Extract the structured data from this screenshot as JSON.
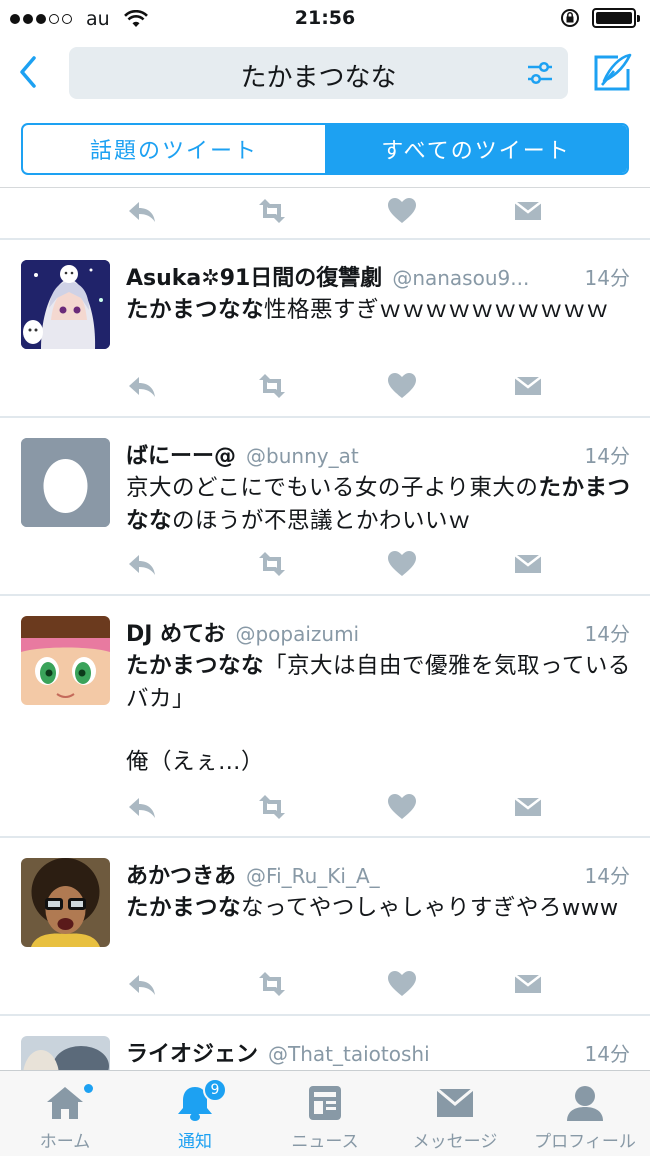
{
  "status_bar": {
    "carrier": "au",
    "time": "21:56"
  },
  "search": {
    "query": "たかまつなな"
  },
  "segments": [
    {
      "label": "話題のツイート",
      "active": false
    },
    {
      "label": "すべてのツイート",
      "active": true
    }
  ],
  "tweets": [
    {
      "name": "Asuka✲91日間の復讐劇",
      "handle": "@nanasou9...",
      "time": "14分",
      "body_bold": "たかまつなな",
      "body_rest": "性格悪すぎｗｗｗｗｗｗｗｗｗｗ"
    },
    {
      "name": "ばにーー@",
      "handle": "@bunny_at",
      "time": "14分",
      "body_pre": "京大のどこにでもいる女の子より東大の",
      "body_bold": "たかまつなな",
      "body_rest": "のほうが不思議とかわいいｗ"
    },
    {
      "name": "DJ めてお",
      "handle": "@popaizumi",
      "time": "14分",
      "body_bold": "たかまつなな",
      "body_rest": "「京大は自由で優雅を気取っているバカ」",
      "body_extra": "俺（えぇ…）"
    },
    {
      "name": "あかつきあ",
      "handle": "@Fi_Ru_Ki_A_",
      "time": "14分",
      "body_bold": "たかまつな",
      "body_rest": "なってやつしゃしゃりすぎやろwww"
    },
    {
      "name": "ライオジェン",
      "handle": "@That_taiotoshi",
      "time": "14分"
    }
  ],
  "tab_bar": {
    "tabs": [
      {
        "label": "ホーム",
        "icon": "home-icon"
      },
      {
        "label": "通知",
        "icon": "bell-icon",
        "badge": "9"
      },
      {
        "label": "ニュース",
        "icon": "news-icon"
      },
      {
        "label": "メッセージ",
        "icon": "envelope-icon"
      },
      {
        "label": "プロフィール",
        "icon": "profile-icon"
      }
    ]
  },
  "colors": {
    "accent": "#1da1f2",
    "muted": "#8899a6",
    "divider": "#e1e8ed"
  }
}
